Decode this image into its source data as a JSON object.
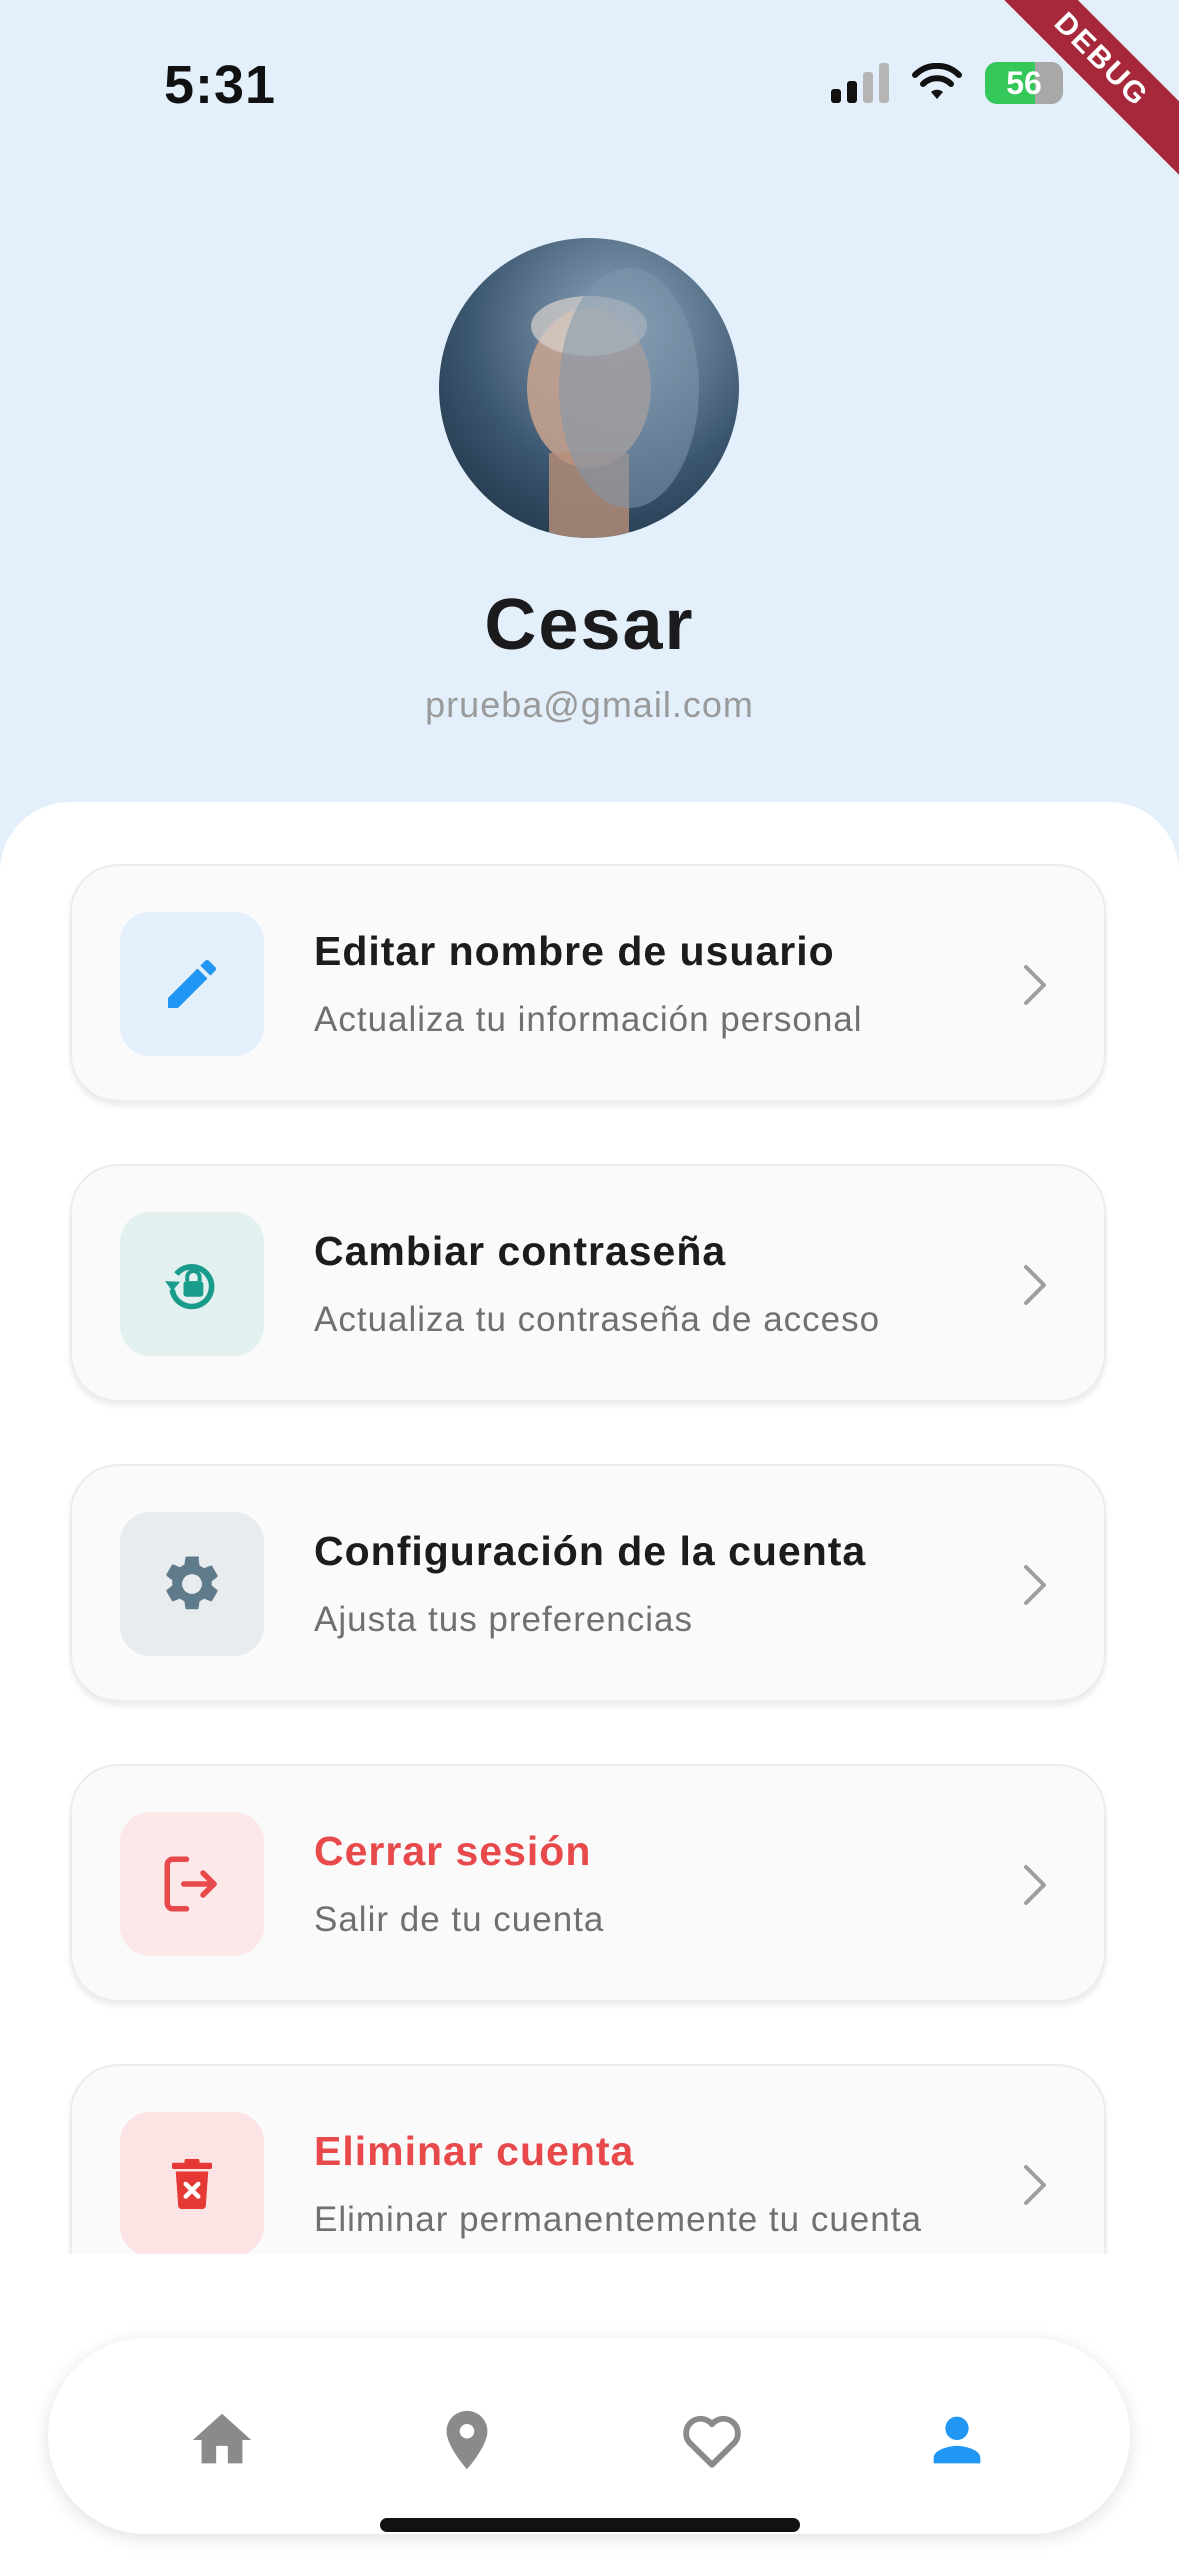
{
  "status_bar": {
    "time": "5:31",
    "battery": "56"
  },
  "debug_banner": "DEBUG",
  "profile": {
    "name": "Cesar",
    "email": "prueba@gmail.com"
  },
  "menu": [
    {
      "title": "Editar nombre de usuario",
      "subtitle": "Actualiza tu información personal",
      "icon": "pencil-icon",
      "danger": false
    },
    {
      "title": "Cambiar contraseña",
      "subtitle": "Actualiza tu contraseña de acceso",
      "icon": "lock-reset-icon",
      "danger": false
    },
    {
      "title": "Configuración de la cuenta",
      "subtitle": "Ajusta tus preferencias",
      "icon": "gear-icon",
      "danger": false
    },
    {
      "title": "Cerrar sesión",
      "subtitle": "Salir de tu cuenta",
      "icon": "logout-icon",
      "danger": true
    },
    {
      "title": "Eliminar cuenta",
      "subtitle": "Eliminar permanentemente tu cuenta",
      "icon": "trash-icon",
      "danger": true
    }
  ],
  "bottom_nav": [
    {
      "icon": "home-icon",
      "active": false
    },
    {
      "icon": "location-pin-icon",
      "active": false
    },
    {
      "icon": "heart-icon",
      "active": false
    },
    {
      "icon": "person-icon",
      "active": true
    }
  ],
  "colors": {
    "header_bg": "#e3f0fc",
    "accent": "#2196f3",
    "teal": "#1a9c8c",
    "gray_icon": "#5f7a8a",
    "danger": "#e8494a"
  }
}
